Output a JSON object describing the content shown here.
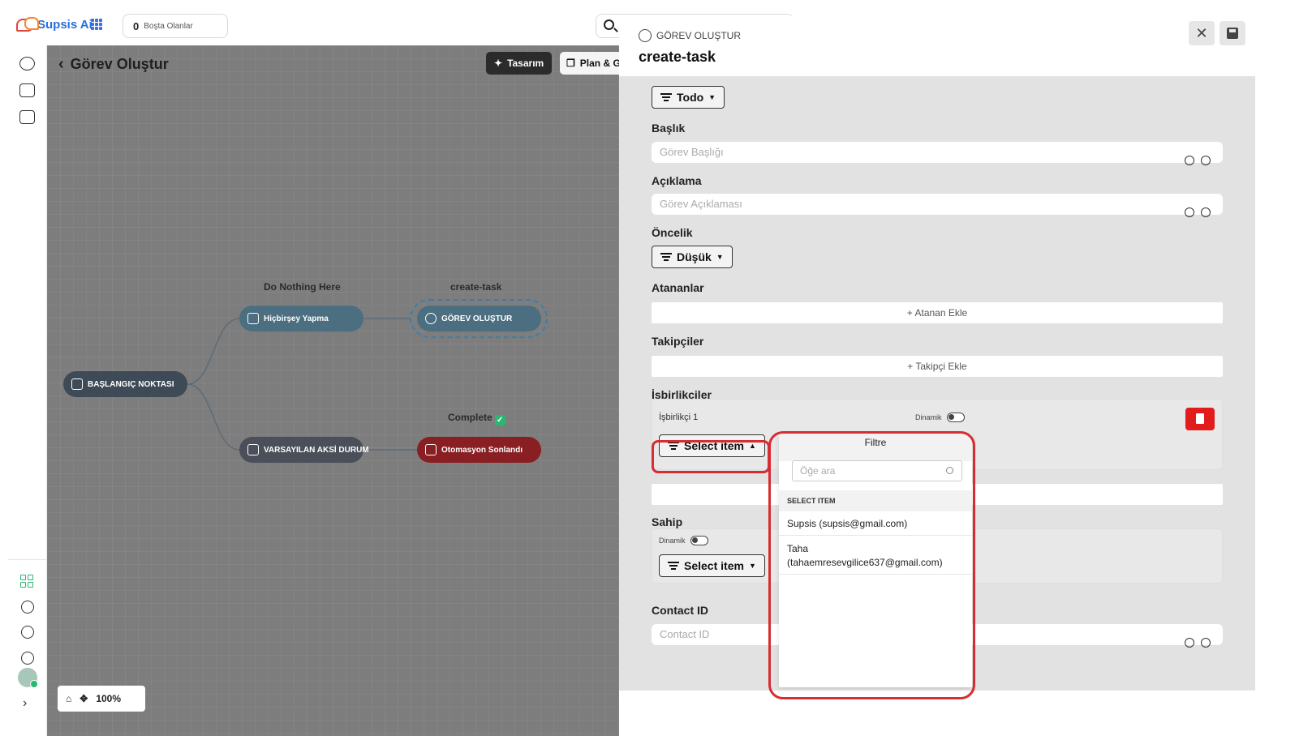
{
  "app": {
    "brand": "Supsis Ai",
    "idle_count": "0",
    "idle_label": "Boşta Olanlar"
  },
  "canvas": {
    "back_title": "Görev Oluştur",
    "tabs": {
      "design": "Tasarım",
      "plan": "Plan & G"
    },
    "nodes": {
      "start": "BAŞLANGIÇ NOKTASI",
      "nothing": "Hiçbirşey Yapma",
      "nothing_label": "Do Nothing Here",
      "task": "GÖREV OLUŞTUR",
      "task_label": "create-task",
      "default": "VARSAYILAN AKSİ DURUM",
      "done": "Otomasyon Sonlandı",
      "done_label": "Complete"
    },
    "zoom": "100%"
  },
  "panel": {
    "subtitle": "GÖREV OLUŞTUR",
    "title": "create-task",
    "status_value": "Todo",
    "title_label": "Başlık",
    "title_placeholder": "Görev Başlığı",
    "desc_label": "Açıklama",
    "desc_placeholder": "Görev Açıklaması",
    "priority_label": "Öncelik",
    "priority_value": "Düşük",
    "assignees_label": "Atananlar",
    "assignees_add": "+ Atanan Ekle",
    "followers_label": "Takipçiler",
    "followers_add": "+ Takipçi Ekle",
    "collab_label": "İşbirlikçiler",
    "collab_item": "İşbirlikçi 1",
    "dynamic_label": "Dinamik",
    "select_item": "Select item",
    "owner_label": "Sahip",
    "contact_label": "Contact ID",
    "contact_placeholder": "Contact ID"
  },
  "dropdown": {
    "header": "Filtre",
    "search_placeholder": "Öğe ara",
    "section": "SELECT ITEM",
    "items": [
      "Supsis (supsis@gmail.com)",
      "Taha (tahaemresevgilice637@gmail.com)"
    ]
  },
  "colors": {
    "accent_red": "#d62c32",
    "brand_blue": "#2a6fdb",
    "node_teal": "#4b6f80",
    "node_dark": "#3f4a57",
    "node_red": "#8a1f23"
  }
}
